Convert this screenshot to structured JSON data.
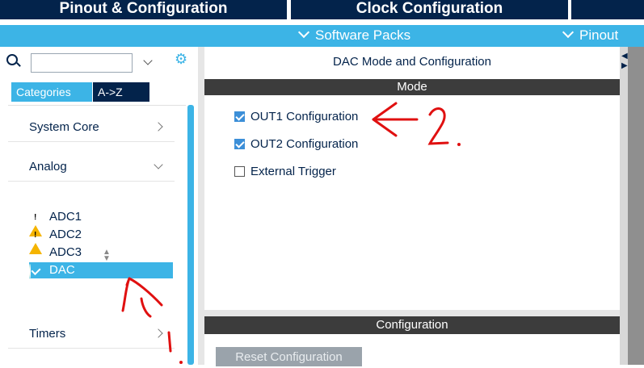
{
  "tabs": {
    "pinout": "Pinout & Configuration",
    "clock": "Clock Configuration"
  },
  "subbar": {
    "software_packs": "Software Packs",
    "pinout": "Pinout"
  },
  "left": {
    "search_placeholder": "",
    "category_tabs": [
      "Categories",
      "A->Z"
    ],
    "categories": [
      {
        "label": "System Core"
      },
      {
        "label": "Analog"
      }
    ],
    "peripherals": [
      {
        "label": "ADC1",
        "status": "warning"
      },
      {
        "label": "ADC2",
        "status": "warning"
      },
      {
        "label": "ADC3",
        "status": "none"
      },
      {
        "label": "DAC",
        "status": "ok"
      }
    ],
    "timers": "Timers"
  },
  "main": {
    "title": "DAC Mode and Configuration",
    "mode_header": "Mode",
    "options": [
      {
        "label": "OUT1 Configuration",
        "checked": true
      },
      {
        "label": "OUT2 Configuration",
        "checked": true
      },
      {
        "label": "External Trigger",
        "checked": false
      }
    ],
    "config_header": "Configuration",
    "reset_button": "Reset Configuration"
  },
  "annotations": {
    "step1": "1.",
    "step2": "2."
  },
  "colors": {
    "dark_navy": "#03234b",
    "accent_blue": "#3cb4e6",
    "header_dark": "#3c3c3c",
    "annotation_red": "#e01010"
  }
}
